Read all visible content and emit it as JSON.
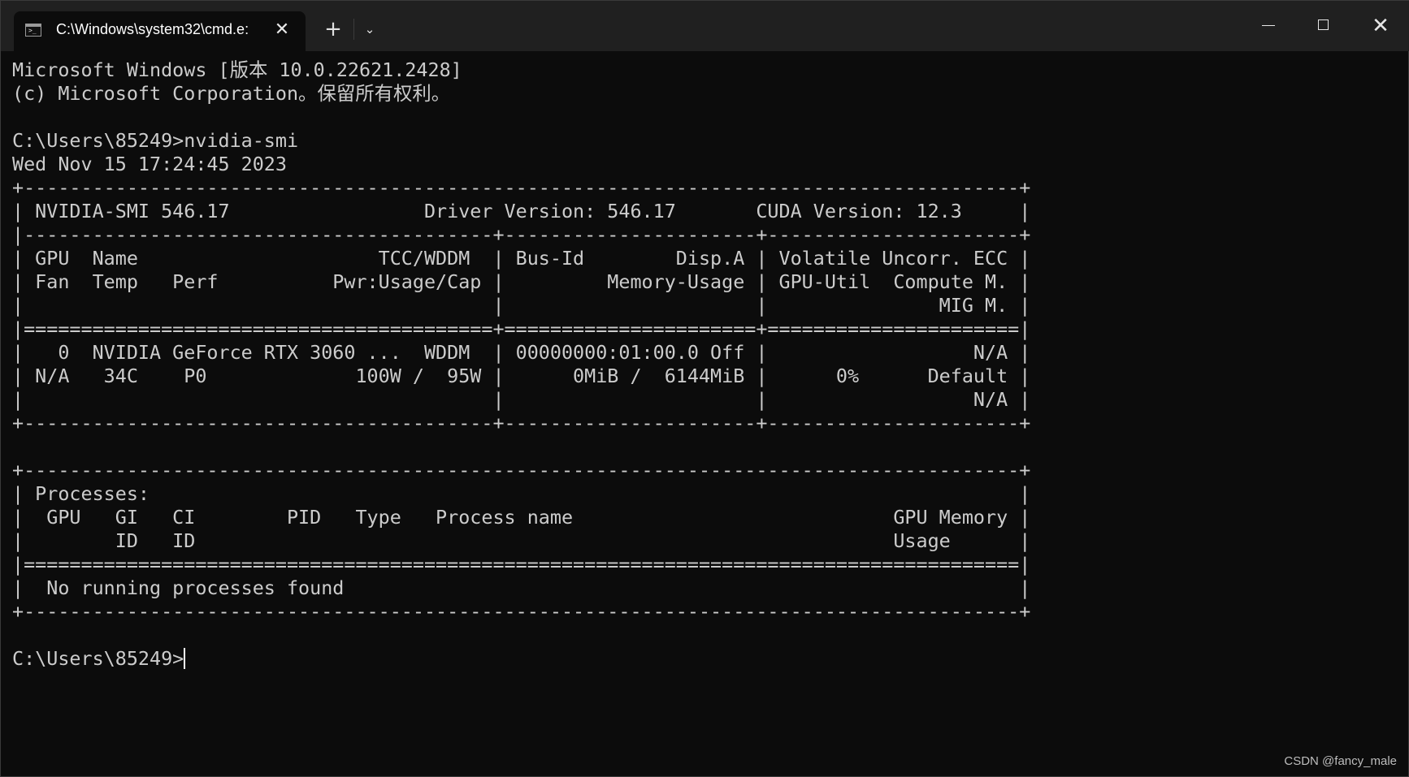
{
  "window": {
    "tab_title": "C:\\Windows\\system32\\cmd.e:",
    "tab_icon_text": ">_",
    "tab_close": "✕",
    "new_tab": "+",
    "dropdown": "⌄",
    "close": "✕"
  },
  "terminal": {
    "lines": [
      "Microsoft Windows [版本 10.0.22621.2428]",
      "(c) Microsoft Corporation。保留所有权利。",
      "",
      "C:\\Users\\85249>nvidia-smi",
      "Wed Nov 15 17:24:45 2023",
      "+---------------------------------------------------------------------------------------+",
      "| NVIDIA-SMI 546.17                 Driver Version: 546.17       CUDA Version: 12.3     |",
      "|-----------------------------------------+----------------------+----------------------+",
      "| GPU  Name                     TCC/WDDM  | Bus-Id        Disp.A | Volatile Uncorr. ECC |",
      "| Fan  Temp   Perf          Pwr:Usage/Cap |         Memory-Usage | GPU-Util  Compute M. |",
      "|                                         |                      |               MIG M. |",
      "|=========================================+======================+======================|",
      "|   0  NVIDIA GeForce RTX 3060 ...  WDDM  | 00000000:01:00.0 Off |                  N/A |",
      "| N/A   34C    P0             100W /  95W |      0MiB /  6144MiB |      0%      Default |",
      "|                                         |                      |                  N/A |",
      "+-----------------------------------------+----------------------+----------------------+",
      "",
      "+---------------------------------------------------------------------------------------+",
      "| Processes:                                                                            |",
      "|  GPU   GI   CI        PID   Type   Process name                            GPU Memory |",
      "|        ID   ID                                                             Usage      |",
      "|=======================================================================================|",
      "|  No running processes found                                                           |",
      "+---------------------------------------------------------------------------------------+",
      "",
      "C:\\Users\\85249>"
    ]
  },
  "watermark": "CSDN @fancy_male"
}
